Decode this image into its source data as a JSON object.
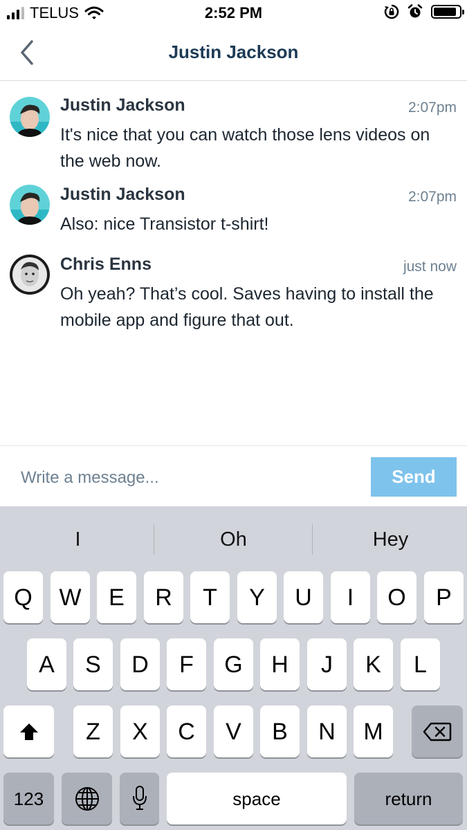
{
  "status_bar": {
    "carrier": "TELUS",
    "time": "2:52 PM",
    "signal_bars": 4,
    "signal_bars_filled": 3,
    "battery_level": 0.9,
    "icons": [
      "wifi-icon",
      "orientation-lock-icon",
      "alarm-icon",
      "battery-icon"
    ]
  },
  "header": {
    "title": "Justin Jackson",
    "back_icon": "chevron-left-icon"
  },
  "messages": [
    {
      "sender": "Justin Jackson",
      "time": "2:07pm",
      "text": "It's nice that you can watch those lens videos on the web now."
    },
    {
      "sender": "Justin Jackson",
      "time": "2:07pm",
      "text": "Also: nice Transistor t-shirt!"
    },
    {
      "sender": "Chris Enns",
      "time": "just now",
      "text": "Oh yeah? That’s cool. Saves having to install the mobile app and figure that out."
    }
  ],
  "composer": {
    "placeholder": "Write a message...",
    "send_label": "Send"
  },
  "keyboard": {
    "suggestions": [
      "I",
      "Oh",
      "Hey"
    ],
    "row1": [
      "Q",
      "W",
      "E",
      "R",
      "T",
      "Y",
      "U",
      "I",
      "O",
      "P"
    ],
    "row2": [
      "A",
      "S",
      "D",
      "F",
      "G",
      "H",
      "J",
      "K",
      "L"
    ],
    "row3": [
      "Z",
      "X",
      "C",
      "V",
      "B",
      "N",
      "M"
    ],
    "numbers_label": "123",
    "space_label": "space",
    "return_label": "return",
    "icons": [
      "shift-icon",
      "backspace-icon",
      "globe-icon",
      "microphone-icon"
    ]
  },
  "colors": {
    "title": "#1d3a55",
    "send_button": "#7ec3ec",
    "timestamp": "#6e8191",
    "keyboard_bg": "#d1d4da"
  }
}
